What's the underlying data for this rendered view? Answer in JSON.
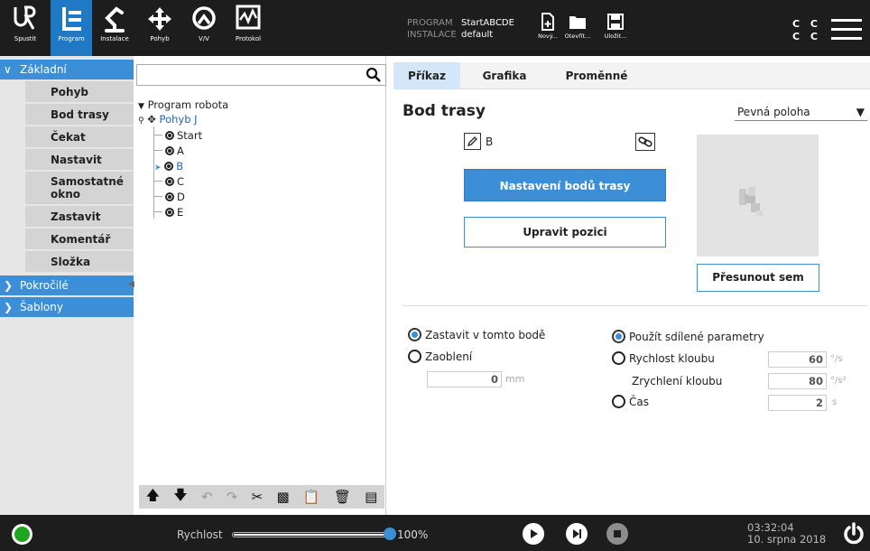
{
  "topbar": {
    "tabs": [
      {
        "label": "Spustit",
        "icon": "ur-logo-icon"
      },
      {
        "label": "Program",
        "icon": "program-icon"
      },
      {
        "label": "Instalace",
        "icon": "robot-arm-icon"
      },
      {
        "label": "Pohyb",
        "icon": "move-arrows-icon"
      },
      {
        "label": "V/V",
        "icon": "io-icon"
      },
      {
        "label": "Protokol",
        "icon": "log-icon"
      }
    ],
    "program_key": "PROGRAM",
    "program_value": "StartABCDE",
    "installation_key": "INSTALACE",
    "installation_value": "default",
    "file_buttons": [
      {
        "label": "Nový...",
        "icon": "new-file-icon"
      },
      {
        "label": "Otevřít...",
        "icon": "folder-icon"
      },
      {
        "label": "Uložit...",
        "icon": "save-icon"
      }
    ],
    "cc_text_1": "C C",
    "cc_text_2": "C C"
  },
  "leftnav": {
    "basic_label": "Základní",
    "basic_items": [
      "Pohyb",
      "Bod trasy",
      "Čekat",
      "Nastavit",
      "Samostatné okno",
      "Zastavit",
      "Komentář",
      "Složka"
    ],
    "advanced_label": "Pokročilé",
    "templates_label": "Šablony"
  },
  "tree": {
    "root": "Program robota",
    "move": "Pohyb J",
    "waypoints": [
      "Start",
      "A",
      "B",
      "C",
      "D",
      "E"
    ],
    "selected": "B"
  },
  "rightpanel": {
    "tabs": [
      "Příkaz",
      "Grafika",
      "Proměnné"
    ],
    "active_tab": "Příkaz",
    "title": "Bod trasy",
    "pose_type": "Pevná poloha",
    "waypoint_name": "B",
    "setup_button": "Nastavení bodů trasy",
    "edit_button": "Upravit pozici",
    "move_here_button": "Přesunout sem",
    "stop_here": "Zastavit v tomto bodě",
    "blend": "Zaoblení",
    "blend_value": "0",
    "blend_unit": "mm",
    "shared_params": "Použít sdílené parametry",
    "joint_speed": "Rychlost kloubu",
    "joint_speed_value": "60",
    "joint_speed_unit": "°/s",
    "joint_accel": "Zrychlení kloubu",
    "joint_accel_value": "80",
    "joint_accel_unit": "°/s²",
    "time": "Čas",
    "time_value": "2",
    "time_unit": "s"
  },
  "bottombar": {
    "speed_label": "Rychlost",
    "speed_value": "100%",
    "speed_fraction": 1.0,
    "time": "03:32:04",
    "date": "10. srpna 2018"
  },
  "colors": {
    "accent": "#3c8fd6",
    "topbar": "#1d1d1d",
    "power_on": "#1fa51f"
  }
}
